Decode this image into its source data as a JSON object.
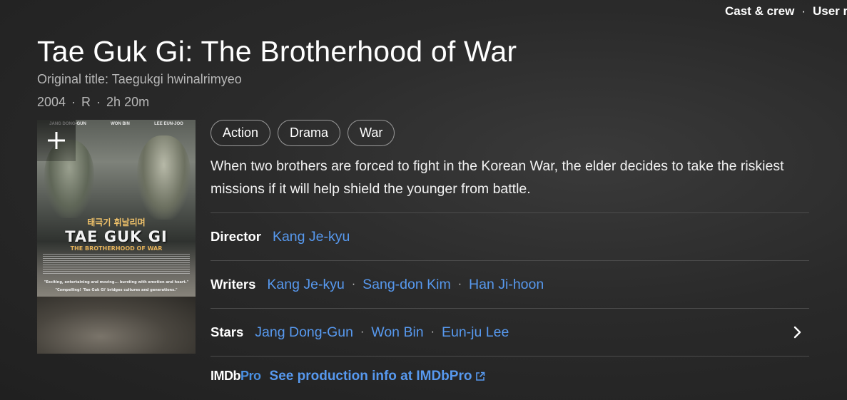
{
  "header": {
    "links": [
      "Cast & crew",
      "User r"
    ]
  },
  "movie": {
    "title": "Tae Guk Gi: The Brotherhood of War",
    "original_title": "Original title: Taegukgi hwinalrimyeo",
    "year": "2004",
    "rating": "R",
    "runtime": "2h 20m",
    "genres": [
      "Action",
      "Drama",
      "War"
    ],
    "plot": "When two brothers are forced to fight in the Korean War, the elder decides to take the riskiest missions if it will help shield the younger from battle."
  },
  "poster": {
    "credits": [
      "JANG DONG-GUN",
      "WON BIN",
      "LEE EUN-JOO"
    ],
    "korean_title": "태극기 휘날리며",
    "title": "TAE GUK GI",
    "subtitle": "THE BROTHERHOOD OF WAR",
    "quote1": "\"Exciting, entertaining and moving... bursting with emotion and heart.\"",
    "quote2": "\"Compelling! 'Tae Guk Gi' bridges cultures and generations.\""
  },
  "credits": {
    "director": {
      "label": "Director",
      "names": [
        "Kang Je-kyu"
      ]
    },
    "writers": {
      "label": "Writers",
      "names": [
        "Kang Je-kyu",
        "Sang-don Kim",
        "Han Ji-hoon"
      ]
    },
    "stars": {
      "label": "Stars",
      "names": [
        "Jang Dong-Gun",
        "Won Bin",
        "Eun-ju Lee"
      ]
    }
  },
  "imdbpro": {
    "logo_imdb": "IMDb",
    "logo_pro": "Pro",
    "link": "See production info at IMDbPro"
  },
  "colors": {
    "link": "#5799ef",
    "background": "#2a2a2a",
    "muted_text": "#b8b8b8"
  }
}
